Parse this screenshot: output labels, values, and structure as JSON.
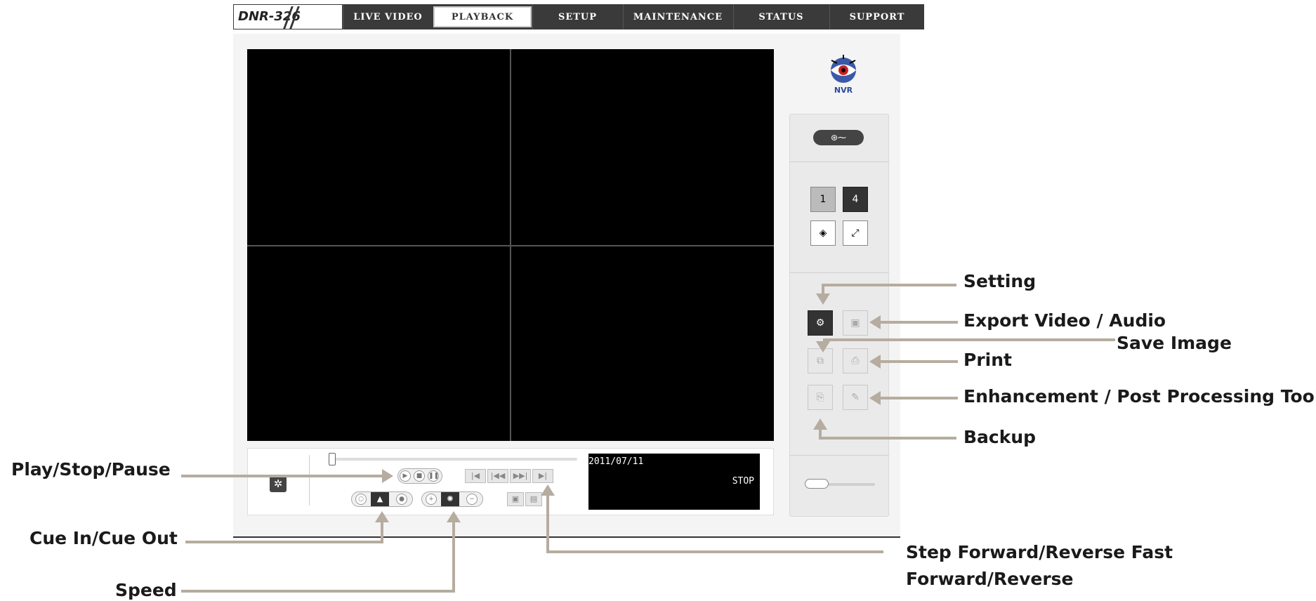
{
  "nav": {
    "brand": "DNR-326",
    "tabs": [
      "LIVE VIDEO",
      "PLAYBACK",
      "SETUP",
      "MAINTENANCE",
      "STATUS",
      "SUPPORT"
    ],
    "active_tab": "PLAYBACK"
  },
  "logo": {
    "text": "NVR"
  },
  "player": {
    "date": "2011/07/11",
    "status": "STOP"
  },
  "annotations": {
    "setting": "Setting",
    "export": "Export Video / Audio",
    "save_image": "Save Image",
    "print": "Print",
    "enhancement": "Enhancement / Post Processing Tool",
    "backup": "Backup",
    "play_stop_pause": "Play/Stop/Pause",
    "cue": "Cue In/Cue Out",
    "speed": "Speed",
    "step_line1": "Step Forward/Reverse Fast",
    "step_line2": "Forward/Reverse"
  },
  "colors": {
    "nav_bg": "#3a3a3a",
    "annotation_line": "#b6ac9f",
    "video_bg": "#000000"
  }
}
